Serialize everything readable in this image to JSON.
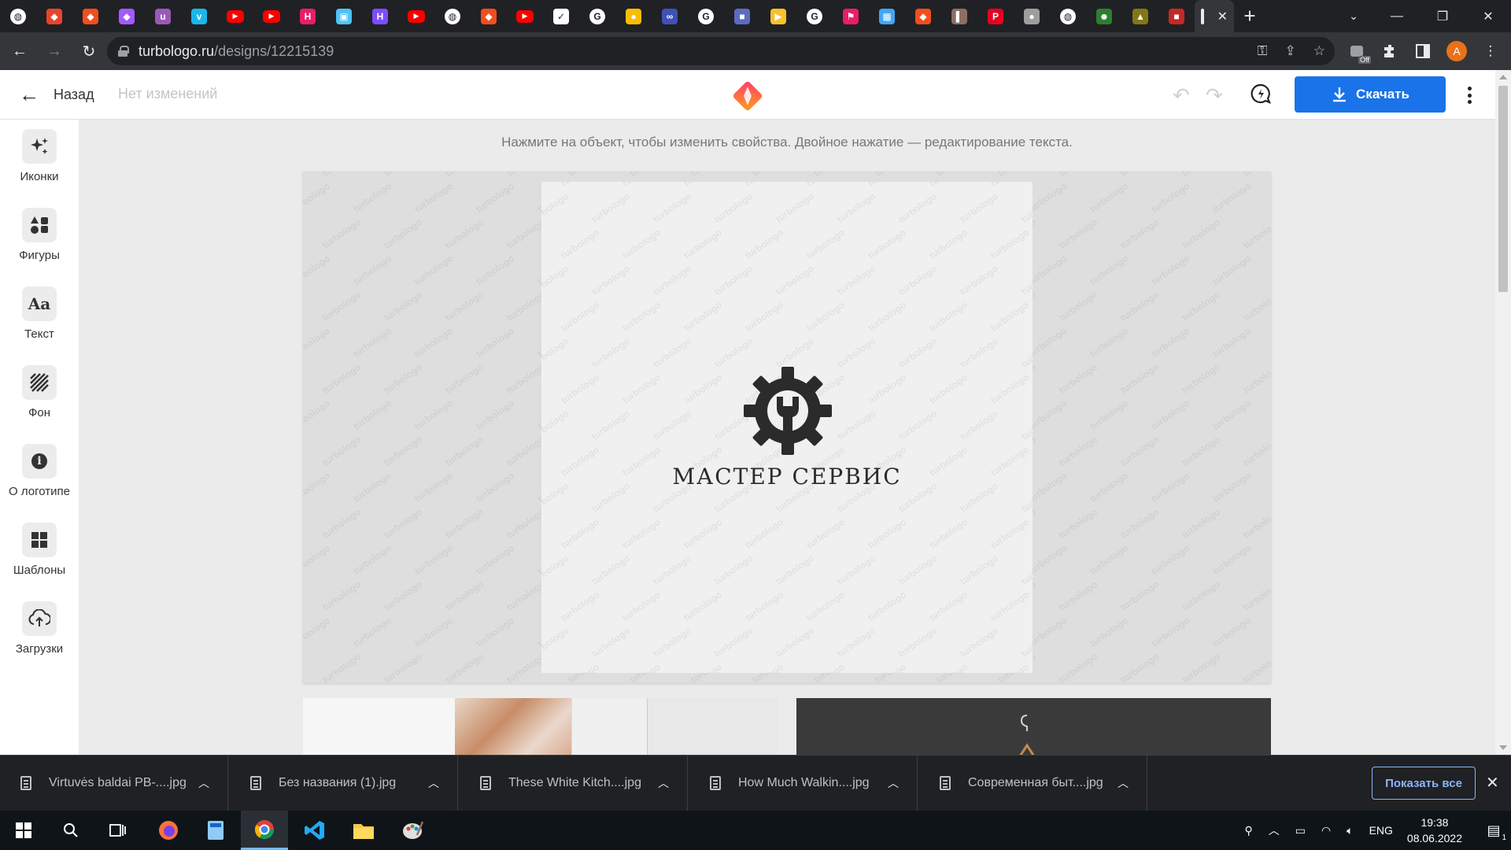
{
  "browser": {
    "tabs": [
      {
        "icon": "chrome-web-icon",
        "color": "#ffffff"
      },
      {
        "icon": "turbologo-icon",
        "color": "#e8442c"
      },
      {
        "icon": "figma-icon",
        "color": "#f24e1e"
      },
      {
        "icon": "figma-icon",
        "color": "#a259ff"
      },
      {
        "icon": "upwork-icon",
        "color": "#9b59b6"
      },
      {
        "icon": "vimeo-icon",
        "color": "#1ab7ea"
      },
      {
        "icon": "youtube-icon",
        "color": "#ff0000"
      },
      {
        "icon": "youtube-icon",
        "color": "#ff0000"
      },
      {
        "icon": "h-icon",
        "color": "#e91e63"
      },
      {
        "icon": "image-icon",
        "color": "#4fc3f7"
      },
      {
        "icon": "h-icon",
        "color": "#7c4dff"
      },
      {
        "icon": "youtube-icon",
        "color": "#ff0000"
      },
      {
        "icon": "globe-icon",
        "color": "#ffffff"
      },
      {
        "icon": "figma-icon",
        "color": "#f24e1e"
      },
      {
        "icon": "youtube-icon",
        "color": "#ff0000"
      },
      {
        "icon": "nike-icon",
        "color": "#ffffff"
      },
      {
        "icon": "google-icon",
        "color": "#ffffff"
      },
      {
        "icon": "donut-icon",
        "color": "#fbbc04"
      },
      {
        "icon": "loop-icon",
        "color": "#3f51b5"
      },
      {
        "icon": "google-icon",
        "color": "#ffffff"
      },
      {
        "icon": "puzzle-icon",
        "color": "#5c6bc0"
      },
      {
        "icon": "play-icon",
        "color": "#fbc02d"
      },
      {
        "icon": "google-icon",
        "color": "#ffffff"
      },
      {
        "icon": "flag-icon",
        "color": "#e91e63"
      },
      {
        "icon": "calendar-icon",
        "color": "#42a5f5"
      },
      {
        "icon": "figma-icon",
        "color": "#f24e1e"
      },
      {
        "icon": "book-icon",
        "color": "#8d6e63"
      },
      {
        "icon": "pinterest-icon",
        "color": "#e60023"
      },
      {
        "icon": "drop-icon",
        "color": "#9e9e9e"
      },
      {
        "icon": "globe-icon",
        "color": "#ffffff"
      },
      {
        "icon": "frog-icon",
        "color": "#2e7d32"
      },
      {
        "icon": "tree-icon",
        "color": "#827717"
      },
      {
        "icon": "record-icon",
        "color": "#c62828"
      }
    ],
    "active_tab_close": "✕",
    "url_host": "turbologo.ru",
    "url_path": "/designs/12215139",
    "profile_initial": "A",
    "extension_badge": "Off"
  },
  "app": {
    "back_label": "Назад",
    "save_status": "Нет изменений",
    "download_label": "Скачать",
    "hint": "Нажмите на объект, чтобы изменить свойства. Двойное нажатие — редактирование текста.",
    "sidebar": [
      {
        "label": "Иконки",
        "icon": "sparkles-icon"
      },
      {
        "label": "Фигуры",
        "icon": "shapes-icon"
      },
      {
        "label": "Текст",
        "icon": "text-icon",
        "glyph": "Aa"
      },
      {
        "label": "Фон",
        "icon": "background-icon"
      },
      {
        "label": "О логотипе",
        "icon": "info-icon",
        "glyph": "i"
      },
      {
        "label": "Шаблоны",
        "icon": "templates-icon"
      },
      {
        "label": "Загрузки",
        "icon": "upload-icon"
      }
    ],
    "logo_text": "МАСТЕР СЕРВИС",
    "watermark": "turbologo",
    "accent": "#1a73e8"
  },
  "downloads": {
    "items": [
      {
        "name": "Virtuvės baldai PB-....jpg"
      },
      {
        "name": "Без названия (1).jpg"
      },
      {
        "name": "These White Kitch....jpg"
      },
      {
        "name": "How Much Walkin....jpg"
      },
      {
        "name": "Современная быт....jpg"
      }
    ],
    "show_all": "Показать все"
  },
  "taskbar": {
    "language": "ENG",
    "time": "19:38",
    "date": "08.06.2022",
    "notification_count": "1"
  }
}
